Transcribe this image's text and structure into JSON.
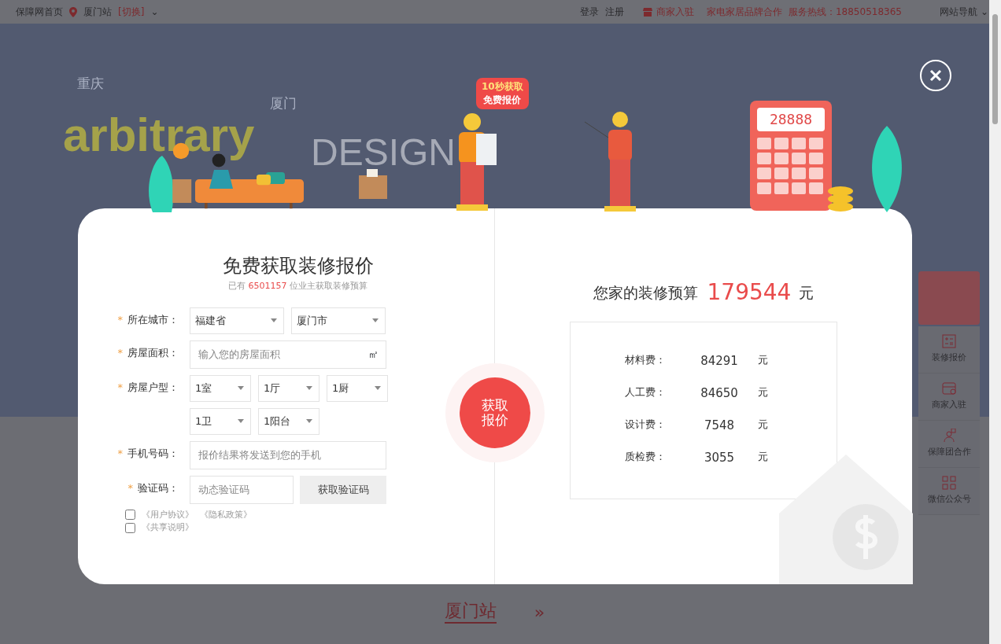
{
  "topbar": {
    "home": "保障网首页",
    "city": "厦门站",
    "switch": "[切换]",
    "login": "登录",
    "register": "注册",
    "merchant": "商家入驻",
    "brand": "家电家居品牌合作",
    "hotline": "服务热线：18850518365",
    "nav": "网站导航",
    "nav_caret": "⌄",
    "city_caret": "⌄"
  },
  "hero": {
    "tags": [
      "重庆",
      "厦门"
    ],
    "headline_1": "arbitrary",
    "headline_2": "DESIGN"
  },
  "float_sidebar": [
    {
      "label": "装修报价"
    },
    {
      "label": "商家入驻"
    },
    {
      "label": "保障团合作"
    },
    {
      "label": "微信公众号"
    }
  ],
  "section_title": "厦门站",
  "section_arrow": "»",
  "modal": {
    "bubble": [
      "10秒获取",
      "免费报价"
    ],
    "calculator_display": "28888",
    "title": "免费获取装修报价",
    "subtitle_prefix": "已有",
    "subtitle_count": "6501157",
    "subtitle_suffix": "位业主获取装修预算",
    "fields": [
      {
        "kind": "selects",
        "required_mark": "*",
        "label": "所在城市：",
        "options": [
          [
            "福建省",
            "厦门市"
          ]
        ]
      },
      {
        "kind": "input",
        "required_mark": "*",
        "label": "房屋面积：",
        "placeholder": "输入您的房屋面积",
        "unit": "㎡"
      },
      {
        "kind": "selects",
        "required_mark": "*",
        "label": "房屋户型：",
        "options": [
          [
            "1室",
            "1厅",
            "1厨"
          ],
          [
            "1卫",
            "1阳台"
          ]
        ]
      },
      {
        "kind": "input",
        "required_mark": "*",
        "label": "手机号码：",
        "placeholder": "报价结果将发送到您的手机"
      },
      {
        "kind": "code",
        "required_mark": "*",
        "label": "验证码：",
        "placeholder": "动态验证码",
        "button": "获取验证码"
      }
    ],
    "agreements": [
      {
        "checked": false,
        "links": [
          "《用户协议》",
          "《隐私政策》"
        ]
      },
      {
        "checked": false,
        "links": [
          "《共享说明》"
        ]
      }
    ],
    "submit": [
      "获取",
      "报价"
    ],
    "budget_label": "您家的装修预算",
    "budget_amount": "179544",
    "budget_unit": "元",
    "costs": [
      {
        "label": "材料费：",
        "value": "84291",
        "unit": "元"
      },
      {
        "label": "人工费：",
        "value": "84650",
        "unit": "元"
      },
      {
        "label": "设计费：",
        "value": "7548",
        "unit": "元"
      },
      {
        "label": "质检费：",
        "value": "3055",
        "unit": "元"
      }
    ]
  }
}
